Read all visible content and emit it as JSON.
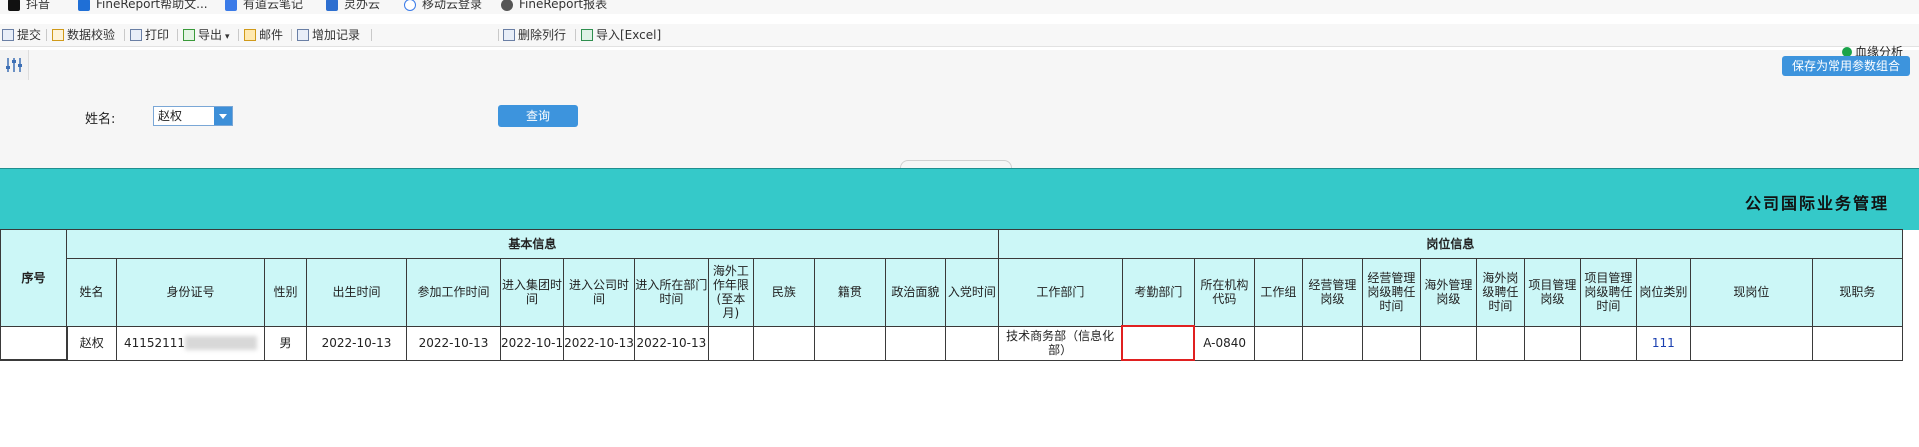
{
  "bookmarks": [
    {
      "label": "抖音",
      "icon": "douyin-icon"
    },
    {
      "label": "FineReport帮助文...",
      "icon": "finereport-icon"
    },
    {
      "label": "有道云笔记",
      "icon": "youdao-note-icon"
    },
    {
      "label": "灵办云",
      "icon": "lingban-icon"
    },
    {
      "label": "移动云登录",
      "icon": "cloud-icon"
    },
    {
      "label": "FineReport报表",
      "icon": "globe-icon"
    }
  ],
  "toolbar": {
    "submit": "提交",
    "validate": "数据校验",
    "print": "打印",
    "export": "导出",
    "mail": "邮件",
    "add_record": "增加记录",
    "delete_row": "删除列行",
    "import_excel": "导入[Excel]"
  },
  "param_panel": {
    "health": "血缘分析",
    "save_combo": "保存为常用参数组合",
    "name_label": "姓名:",
    "name_value": "赵权",
    "query_button": "查询"
  },
  "report": {
    "title": "公司国际业务管理",
    "seq_header": "序号",
    "group_basic": "基本信息",
    "group_position": "岗位信息",
    "columns": [
      "姓名",
      "身份证号",
      "性别",
      "出生时间",
      "参加工作时间",
      "进入集团时间",
      "进入公司时间",
      "进入所在部门时间",
      "海外工作年限(至本月)",
      "民族",
      "籍贯",
      "政治面貌",
      "入党时间",
      "工作部门",
      "考勤部门",
      "所在机构代码",
      "工作组",
      "经营管理岗级",
      "经营管理岗级聘任时间",
      "海外管理岗级",
      "海外岗级聘任时间",
      "项目管理岗级",
      "项目管理岗级聘任时间",
      "岗位类别",
      "现岗位",
      "现职务"
    ],
    "row": {
      "seq": "",
      "name": "赵权",
      "id_no": "41152111",
      "gender": "男",
      "birth": "2022-10-13",
      "work_start": "2022-10-13",
      "group_join": "2022-10-1",
      "company_join": "2022-10-13",
      "dept_join": "2022-10-13",
      "overseas_years": "",
      "ethnicity": "",
      "native": "",
      "political": "",
      "party_join": "",
      "work_dept": "技术商务部（信息化部）",
      "attendance_dept": "",
      "org_code": "A-0840",
      "work_group": "",
      "mgmt_level": "",
      "mgmt_time": "",
      "overseas_level": "",
      "overseas_time": "",
      "project_level": "",
      "project_time": "",
      "post_type": "111",
      "current_post": "",
      "current_duty": ""
    }
  },
  "colors": {
    "accent": "#3d94dd",
    "title_band": "#35c9c9",
    "header_bg": "#ccf7f7",
    "error": "#e02020"
  }
}
